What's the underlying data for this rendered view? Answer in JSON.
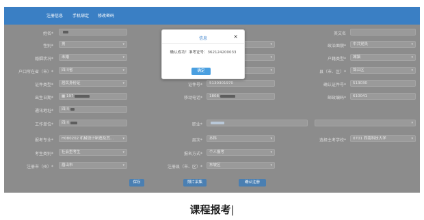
{
  "tabs": [
    "注册信息",
    "手机绑定",
    "修改密码"
  ],
  "fields": [
    {
      "label": "姓名*",
      "value": "",
      "masked": true
    },
    {
      "label": "性别*",
      "value": "男"
    },
    {
      "label": "婚姻状况*",
      "value": "未婚"
    },
    {
      "label": "户口所在省（市）*",
      "value": "四川省"
    },
    {
      "label": "证件类型*",
      "value": "居民身份证"
    },
    {
      "label": "出生日期*",
      "value": "197",
      "masked": true
    },
    {
      "label": "通讯地址*",
      "value": "四川",
      "masked": true
    },
    {
      "label": "工作单位*",
      "value": "四川",
      "masked": true
    },
    {
      "label": "报考专业*",
      "value": "H080202 机械设计制造及其..."
    },
    {
      "label": "考生类别*",
      "value": "社会型考生"
    },
    {
      "label": "注册市（州）*",
      "value": "眉山市"
    }
  ],
  "middle_fields": [
    {
      "label": "证件号*",
      "value": "5130301970"
    },
    {
      "label": "移动电话*",
      "value": "1808",
      "masked": true
    },
    {
      "label": "职业*",
      "value": "",
      "masked": true
    },
    {
      "label": "层次*",
      "value": "本科"
    },
    {
      "label": "报名方式*",
      "value": "个人报考"
    },
    {
      "label": "注册县（市、区）*",
      "value": "东坡区"
    }
  ],
  "right_fields": [
    {
      "label": "英文名",
      "value": ""
    },
    {
      "label": "政治面貌*",
      "value": "中共党员"
    },
    {
      "label": "户籍类型*",
      "value": "城镇"
    },
    {
      "label": "县（市、区）*",
      "value": "锦江区"
    },
    {
      "label": "确认证件号*",
      "value": "513030"
    },
    {
      "label": "邮政编码*",
      "value": "610041"
    },
    {
      "label": "",
      "value": ""
    },
    {
      "label": "选择主考学校*",
      "value": "0701 西南科技大学"
    }
  ],
  "buttons": {
    "save": "保存",
    "photo": "照片采集",
    "confirm_register": "确认注册"
  },
  "modal": {
    "title": "信息",
    "close": "×",
    "message": "确认成功！准考证号：362124200033",
    "ok": "确定"
  },
  "caption": "课程报考",
  "caption_cursor": "|"
}
